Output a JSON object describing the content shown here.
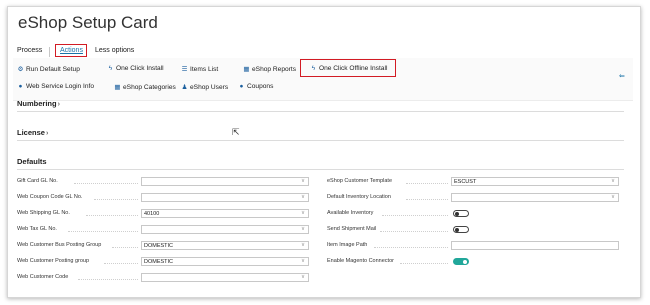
{
  "page": {
    "title": "eShop Setup Card"
  },
  "menu": {
    "process": "Process",
    "actions": "Actions",
    "less_options": "Less options"
  },
  "actions": {
    "run_default_setup": "Run Default Setup",
    "one_click_install": "One Click Install",
    "items_list": "Items List",
    "eshop_reports": "eShop Reports",
    "one_click_offline_install": "One Click Offline Install",
    "web_service_login_info": "Web Service Login Info",
    "eshop_categories": "eShop Categories",
    "eshop_users": "eShop Users",
    "coupons": "Coupons"
  },
  "sections": {
    "numbering": "Numbering",
    "license": "License",
    "defaults": "Defaults"
  },
  "left_fields": [
    {
      "label": "Gift Card GL No.",
      "value": ""
    },
    {
      "label": "Web Coupon Code GL No.",
      "value": ""
    },
    {
      "label": "Web Shipping GL No.",
      "value": "40100"
    },
    {
      "label": "Web Tax GL No.",
      "value": ""
    },
    {
      "label": "Web Customer Bus Posting Group",
      "value": "DOMESTIC"
    },
    {
      "label": "Web Customer Posting group",
      "value": "DOMESTIC"
    },
    {
      "label": "Web Customer Code",
      "value": ""
    }
  ],
  "right_fields": [
    {
      "label": "eShop Customer Template",
      "value": "ESCUST"
    },
    {
      "label": "Default Inventory Location",
      "value": ""
    },
    {
      "label": "Available Inventory",
      "toggle": false
    },
    {
      "label": "Send Shipment Mail",
      "toggle": false
    },
    {
      "label": "Item Image Path",
      "value": ""
    },
    {
      "label": "Enable Magento Connector",
      "toggle": true
    }
  ],
  "colors": {
    "accent": "#1a73a8",
    "highlight_box": "#d21b24",
    "toggle_on": "#21a79a"
  }
}
